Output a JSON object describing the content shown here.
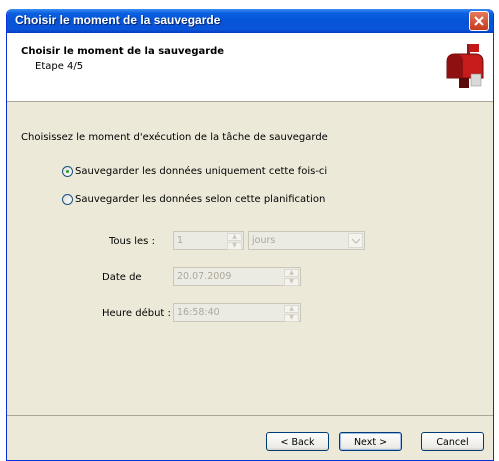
{
  "window": {
    "title": "Choisir le moment de la sauvegarde"
  },
  "header": {
    "title": "Choisir le moment de la sauvegarde",
    "subtitle": "Etape 4/5",
    "icon": "mailbox-icon"
  },
  "main": {
    "intro": "Choisissez le moment d'exécution de la tâche de sauvegarde",
    "options": [
      {
        "label": "Sauvegarder les données uniquement cette fois-ci",
        "checked": true
      },
      {
        "label": "Sauvegarder les données selon cette planification",
        "checked": false
      }
    ],
    "schedule": {
      "every_label": "Tous les :",
      "every_value": "1",
      "unit_value": "jours",
      "date_label": "Date de",
      "date_value": "20.07.2009",
      "time_label": "Heure début :",
      "time_value": "16:58:40"
    }
  },
  "footer": {
    "back_label": "< Back",
    "next_label": "Next >",
    "cancel_label": "Cancel"
  },
  "colors": {
    "titlebar": "#0653d6",
    "window_bg": "#ece9d8",
    "radio_dot": "#21a121"
  }
}
